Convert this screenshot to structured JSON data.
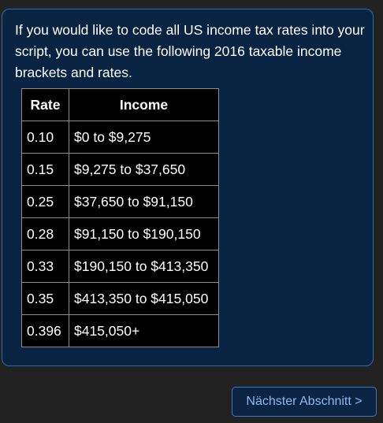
{
  "intro_text": "If you would like to code all US income tax rates into your script, you can use the following 2016 taxable income brackets and rates.",
  "table": {
    "headers": [
      "Rate",
      "Income"
    ],
    "rows": [
      [
        "0.10",
        "$0 to $9,275"
      ],
      [
        "0.15",
        "$9,275 to $37,650"
      ],
      [
        "0.25",
        "$37,650 to $91,150"
      ],
      [
        "0.28",
        "$91,150 to $190,150"
      ],
      [
        "0.33",
        "$190,150 to $413,350"
      ],
      [
        "0.35",
        "$413,350 to $415,050"
      ],
      [
        "0.396",
        "$415,050+"
      ]
    ]
  },
  "next_button_label": "Nächster Abschnitt >",
  "colors": {
    "page_background": "#222222",
    "card_background": "#092442",
    "card_border": "#2f6aa8",
    "table_background": "#000000",
    "button_text": "#8fb8ee"
  }
}
